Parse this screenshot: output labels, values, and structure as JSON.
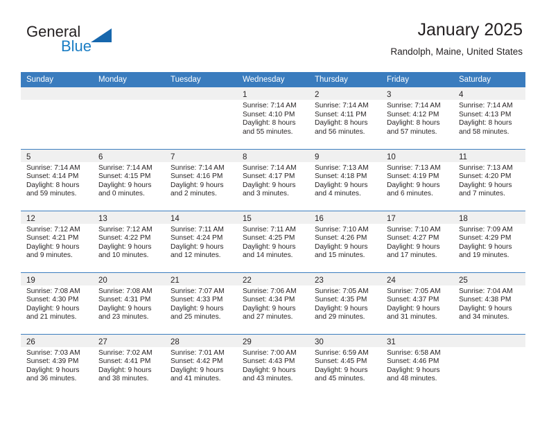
{
  "brand": {
    "name_part1": "General",
    "name_part2": "Blue",
    "flag_icon": "triangle-flag-icon",
    "accent_color": "#1a7dc4"
  },
  "header": {
    "title": "January 2025",
    "subtitle": "Randolph, Maine, United States"
  },
  "theme": {
    "header_row_bg": "#3a7cbe",
    "daynum_band_bg": "#f0f0f0",
    "text_color": "#231f20"
  },
  "weekday_headers": [
    "Sunday",
    "Monday",
    "Tuesday",
    "Wednesday",
    "Thursday",
    "Friday",
    "Saturday"
  ],
  "weeks": [
    [
      {
        "day": "",
        "sunrise": "",
        "sunset": "",
        "daylight_line1": "",
        "daylight_line2": ""
      },
      {
        "day": "",
        "sunrise": "",
        "sunset": "",
        "daylight_line1": "",
        "daylight_line2": ""
      },
      {
        "day": "",
        "sunrise": "",
        "sunset": "",
        "daylight_line1": "",
        "daylight_line2": ""
      },
      {
        "day": "1",
        "sunrise": "Sunrise: 7:14 AM",
        "sunset": "Sunset: 4:10 PM",
        "daylight_line1": "Daylight: 8 hours",
        "daylight_line2": "and 55 minutes."
      },
      {
        "day": "2",
        "sunrise": "Sunrise: 7:14 AM",
        "sunset": "Sunset: 4:11 PM",
        "daylight_line1": "Daylight: 8 hours",
        "daylight_line2": "and 56 minutes."
      },
      {
        "day": "3",
        "sunrise": "Sunrise: 7:14 AM",
        "sunset": "Sunset: 4:12 PM",
        "daylight_line1": "Daylight: 8 hours",
        "daylight_line2": "and 57 minutes."
      },
      {
        "day": "4",
        "sunrise": "Sunrise: 7:14 AM",
        "sunset": "Sunset: 4:13 PM",
        "daylight_line1": "Daylight: 8 hours",
        "daylight_line2": "and 58 minutes."
      }
    ],
    [
      {
        "day": "5",
        "sunrise": "Sunrise: 7:14 AM",
        "sunset": "Sunset: 4:14 PM",
        "daylight_line1": "Daylight: 8 hours",
        "daylight_line2": "and 59 minutes."
      },
      {
        "day": "6",
        "sunrise": "Sunrise: 7:14 AM",
        "sunset": "Sunset: 4:15 PM",
        "daylight_line1": "Daylight: 9 hours",
        "daylight_line2": "and 0 minutes."
      },
      {
        "day": "7",
        "sunrise": "Sunrise: 7:14 AM",
        "sunset": "Sunset: 4:16 PM",
        "daylight_line1": "Daylight: 9 hours",
        "daylight_line2": "and 2 minutes."
      },
      {
        "day": "8",
        "sunrise": "Sunrise: 7:14 AM",
        "sunset": "Sunset: 4:17 PM",
        "daylight_line1": "Daylight: 9 hours",
        "daylight_line2": "and 3 minutes."
      },
      {
        "day": "9",
        "sunrise": "Sunrise: 7:13 AM",
        "sunset": "Sunset: 4:18 PM",
        "daylight_line1": "Daylight: 9 hours",
        "daylight_line2": "and 4 minutes."
      },
      {
        "day": "10",
        "sunrise": "Sunrise: 7:13 AM",
        "sunset": "Sunset: 4:19 PM",
        "daylight_line1": "Daylight: 9 hours",
        "daylight_line2": "and 6 minutes."
      },
      {
        "day": "11",
        "sunrise": "Sunrise: 7:13 AM",
        "sunset": "Sunset: 4:20 PM",
        "daylight_line1": "Daylight: 9 hours",
        "daylight_line2": "and 7 minutes."
      }
    ],
    [
      {
        "day": "12",
        "sunrise": "Sunrise: 7:12 AM",
        "sunset": "Sunset: 4:21 PM",
        "daylight_line1": "Daylight: 9 hours",
        "daylight_line2": "and 9 minutes."
      },
      {
        "day": "13",
        "sunrise": "Sunrise: 7:12 AM",
        "sunset": "Sunset: 4:22 PM",
        "daylight_line1": "Daylight: 9 hours",
        "daylight_line2": "and 10 minutes."
      },
      {
        "day": "14",
        "sunrise": "Sunrise: 7:11 AM",
        "sunset": "Sunset: 4:24 PM",
        "daylight_line1": "Daylight: 9 hours",
        "daylight_line2": "and 12 minutes."
      },
      {
        "day": "15",
        "sunrise": "Sunrise: 7:11 AM",
        "sunset": "Sunset: 4:25 PM",
        "daylight_line1": "Daylight: 9 hours",
        "daylight_line2": "and 14 minutes."
      },
      {
        "day": "16",
        "sunrise": "Sunrise: 7:10 AM",
        "sunset": "Sunset: 4:26 PM",
        "daylight_line1": "Daylight: 9 hours",
        "daylight_line2": "and 15 minutes."
      },
      {
        "day": "17",
        "sunrise": "Sunrise: 7:10 AM",
        "sunset": "Sunset: 4:27 PM",
        "daylight_line1": "Daylight: 9 hours",
        "daylight_line2": "and 17 minutes."
      },
      {
        "day": "18",
        "sunrise": "Sunrise: 7:09 AM",
        "sunset": "Sunset: 4:29 PM",
        "daylight_line1": "Daylight: 9 hours",
        "daylight_line2": "and 19 minutes."
      }
    ],
    [
      {
        "day": "19",
        "sunrise": "Sunrise: 7:08 AM",
        "sunset": "Sunset: 4:30 PM",
        "daylight_line1": "Daylight: 9 hours",
        "daylight_line2": "and 21 minutes."
      },
      {
        "day": "20",
        "sunrise": "Sunrise: 7:08 AM",
        "sunset": "Sunset: 4:31 PM",
        "daylight_line1": "Daylight: 9 hours",
        "daylight_line2": "and 23 minutes."
      },
      {
        "day": "21",
        "sunrise": "Sunrise: 7:07 AM",
        "sunset": "Sunset: 4:33 PM",
        "daylight_line1": "Daylight: 9 hours",
        "daylight_line2": "and 25 minutes."
      },
      {
        "day": "22",
        "sunrise": "Sunrise: 7:06 AM",
        "sunset": "Sunset: 4:34 PM",
        "daylight_line1": "Daylight: 9 hours",
        "daylight_line2": "and 27 minutes."
      },
      {
        "day": "23",
        "sunrise": "Sunrise: 7:05 AM",
        "sunset": "Sunset: 4:35 PM",
        "daylight_line1": "Daylight: 9 hours",
        "daylight_line2": "and 29 minutes."
      },
      {
        "day": "24",
        "sunrise": "Sunrise: 7:05 AM",
        "sunset": "Sunset: 4:37 PM",
        "daylight_line1": "Daylight: 9 hours",
        "daylight_line2": "and 31 minutes."
      },
      {
        "day": "25",
        "sunrise": "Sunrise: 7:04 AM",
        "sunset": "Sunset: 4:38 PM",
        "daylight_line1": "Daylight: 9 hours",
        "daylight_line2": "and 34 minutes."
      }
    ],
    [
      {
        "day": "26",
        "sunrise": "Sunrise: 7:03 AM",
        "sunset": "Sunset: 4:39 PM",
        "daylight_line1": "Daylight: 9 hours",
        "daylight_line2": "and 36 minutes."
      },
      {
        "day": "27",
        "sunrise": "Sunrise: 7:02 AM",
        "sunset": "Sunset: 4:41 PM",
        "daylight_line1": "Daylight: 9 hours",
        "daylight_line2": "and 38 minutes."
      },
      {
        "day": "28",
        "sunrise": "Sunrise: 7:01 AM",
        "sunset": "Sunset: 4:42 PM",
        "daylight_line1": "Daylight: 9 hours",
        "daylight_line2": "and 41 minutes."
      },
      {
        "day": "29",
        "sunrise": "Sunrise: 7:00 AM",
        "sunset": "Sunset: 4:43 PM",
        "daylight_line1": "Daylight: 9 hours",
        "daylight_line2": "and 43 minutes."
      },
      {
        "day": "30",
        "sunrise": "Sunrise: 6:59 AM",
        "sunset": "Sunset: 4:45 PM",
        "daylight_line1": "Daylight: 9 hours",
        "daylight_line2": "and 45 minutes."
      },
      {
        "day": "31",
        "sunrise": "Sunrise: 6:58 AM",
        "sunset": "Sunset: 4:46 PM",
        "daylight_line1": "Daylight: 9 hours",
        "daylight_line2": "and 48 minutes."
      },
      {
        "day": "",
        "sunrise": "",
        "sunset": "",
        "daylight_line1": "",
        "daylight_line2": ""
      }
    ]
  ]
}
